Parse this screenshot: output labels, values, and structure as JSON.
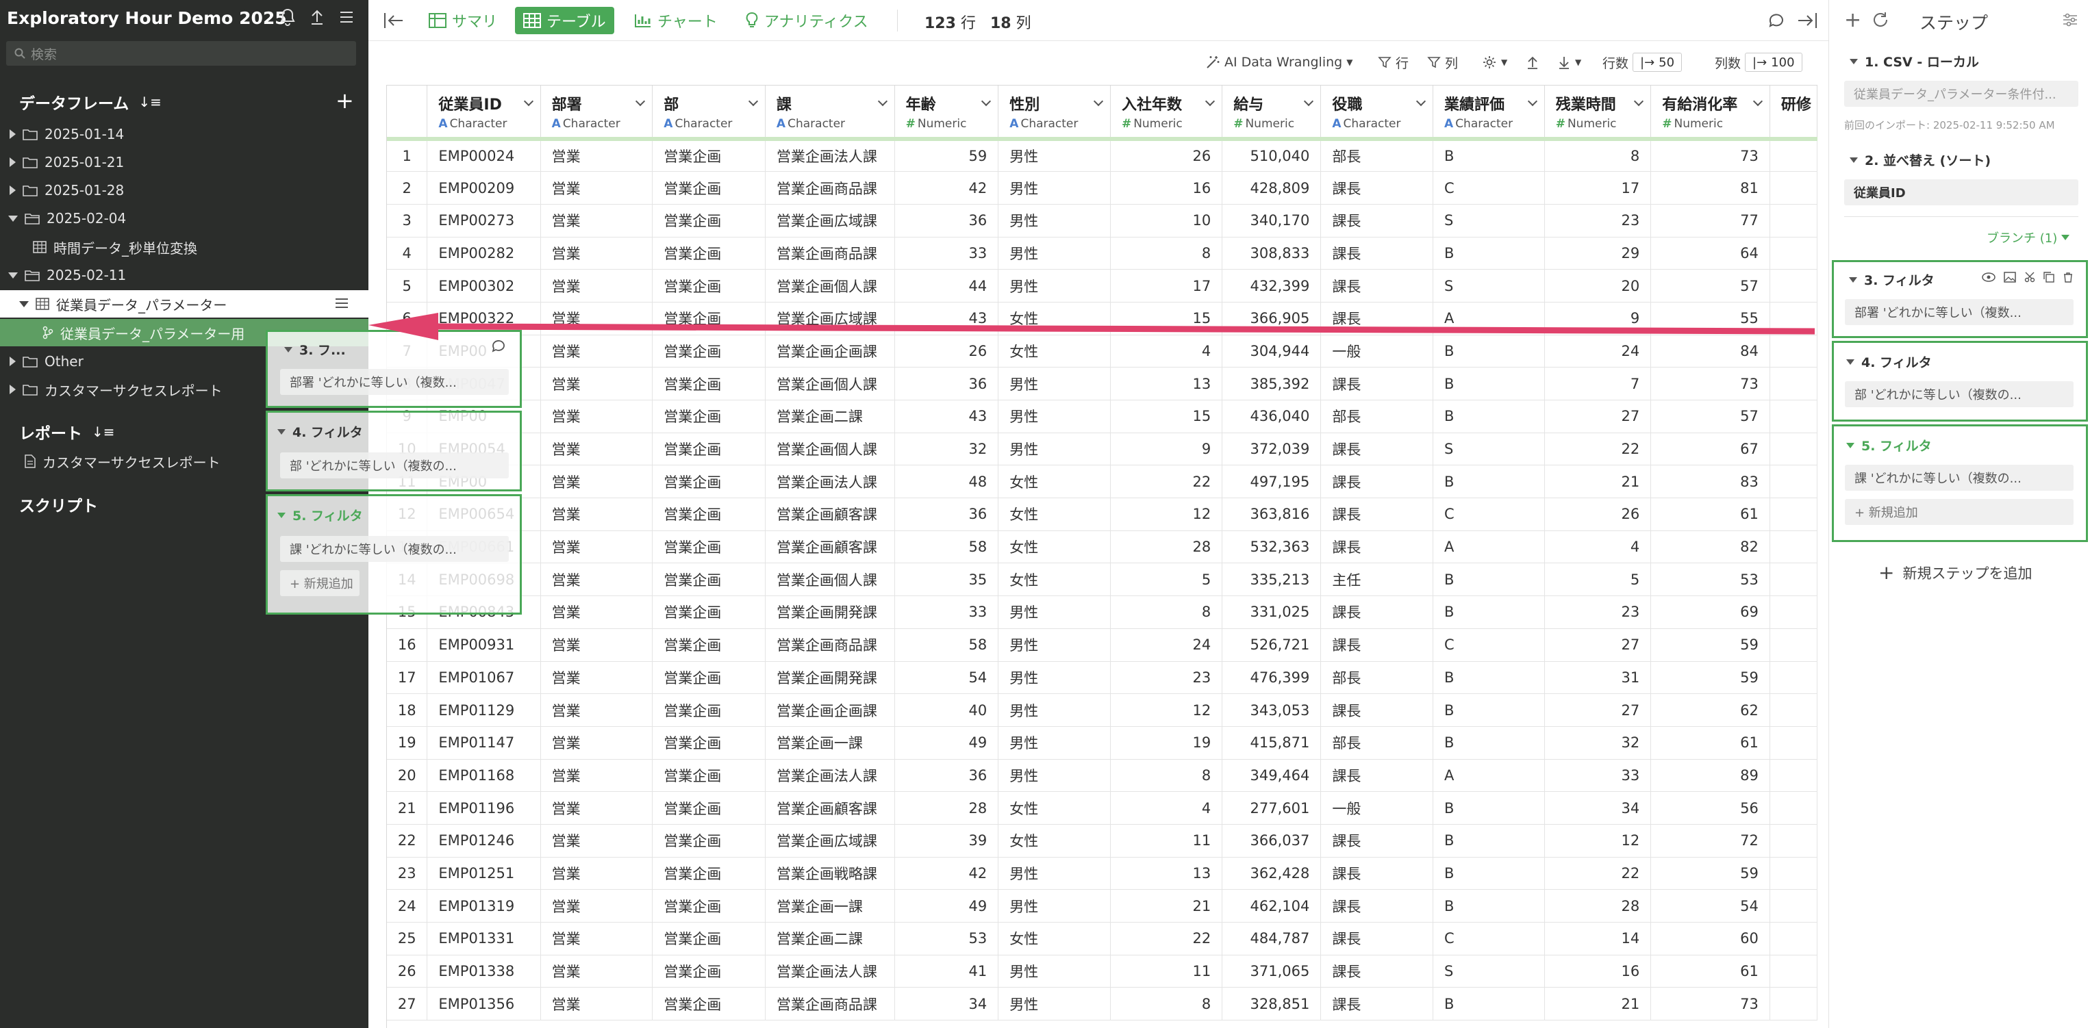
{
  "sidebar": {
    "title": "Exploratory Hour Demo 2025",
    "search_placeholder": "検索",
    "dataframes_heading": "データフレーム",
    "folders": [
      {
        "label": "2025-01-14"
      },
      {
        "label": "2025-01-21"
      },
      {
        "label": "2025-01-28"
      },
      {
        "label": "2025-02-04"
      },
      {
        "label": "時間データ_秒単位変換"
      },
      {
        "label": "2025-02-11"
      },
      {
        "label": "従業員データ_パラメーター"
      },
      {
        "label": "従業員データ_パラメーター用"
      },
      {
        "label": "Other"
      },
      {
        "label": "カスタマーサクセスレポート"
      }
    ],
    "reports_heading": "レポート",
    "report_item": "カスタマーサクセスレポート",
    "scripts_heading": "スクリプト"
  },
  "toolbar": {
    "tabs": [
      "サマリ",
      "テーブル",
      "チャート",
      "アナリティクス"
    ],
    "rows": "123",
    "rows_unit": "行",
    "cols": "18",
    "cols_unit": "列",
    "ai_label": "AI Data Wrangling",
    "row_filter": "行",
    "col_filter": "列",
    "row_count_label": "行数",
    "row_count_value": "50",
    "col_count_label": "列数",
    "col_count_value": "100"
  },
  "table": {
    "columns": [
      {
        "name": "従業員ID",
        "type": "Character"
      },
      {
        "name": "部署",
        "type": "Character"
      },
      {
        "name": "部",
        "type": "Character"
      },
      {
        "name": "課",
        "type": "Character"
      },
      {
        "name": "年齢",
        "type": "Numeric"
      },
      {
        "name": "性別",
        "type": "Character"
      },
      {
        "name": "入社年数",
        "type": "Numeric"
      },
      {
        "name": "給与",
        "type": "Numeric"
      },
      {
        "name": "役職",
        "type": "Character"
      },
      {
        "name": "業績評価",
        "type": "Character"
      },
      {
        "name": "残業時間",
        "type": "Numeric"
      },
      {
        "name": "有給消化率",
        "type": "Numeric"
      },
      {
        "name": "研修",
        "type": ""
      }
    ],
    "rows": [
      [
        "1",
        "EMP00024",
        "営業",
        "営業企画",
        "営業企画法人課",
        "59",
        "男性",
        "26",
        "510,040",
        "部長",
        "B",
        "8",
        "73"
      ],
      [
        "2",
        "EMP00209",
        "営業",
        "営業企画",
        "営業企画商品課",
        "42",
        "男性",
        "16",
        "428,809",
        "課長",
        "C",
        "17",
        "81"
      ],
      [
        "3",
        "EMP00273",
        "営業",
        "営業企画",
        "営業企画広域課",
        "36",
        "男性",
        "10",
        "340,170",
        "課長",
        "S",
        "23",
        "77"
      ],
      [
        "4",
        "EMP00282",
        "営業",
        "営業企画",
        "営業企画商品課",
        "33",
        "男性",
        "8",
        "308,833",
        "課長",
        "B",
        "29",
        "64"
      ],
      [
        "5",
        "EMP00302",
        "営業",
        "営業企画",
        "営業企画個人課",
        "44",
        "男性",
        "17",
        "432,399",
        "課長",
        "S",
        "20",
        "57"
      ],
      [
        "6",
        "EMP00322",
        "営業",
        "営業企画",
        "営業企画広域課",
        "43",
        "女性",
        "15",
        "366,905",
        "課長",
        "A",
        "9",
        "55"
      ],
      [
        "7",
        "EMP00",
        "営業",
        "営業企画",
        "営業企画企画課",
        "26",
        "女性",
        "4",
        "304,944",
        "一般",
        "B",
        "24",
        "84"
      ],
      [
        "8",
        "EMP0047",
        "営業",
        "営業企画",
        "営業企画個人課",
        "36",
        "男性",
        "13",
        "385,392",
        "課長",
        "B",
        "7",
        "73"
      ],
      [
        "9",
        "EMP00",
        "営業",
        "営業企画",
        "営業企画二課",
        "43",
        "男性",
        "15",
        "436,040",
        "部長",
        "B",
        "27",
        "57"
      ],
      [
        "10",
        "EMP0054",
        "営業",
        "営業企画",
        "営業企画個人課",
        "32",
        "男性",
        "9",
        "372,039",
        "課長",
        "S",
        "22",
        "67"
      ],
      [
        "11",
        "EMP00",
        "営業",
        "営業企画",
        "営業企画法人課",
        "48",
        "女性",
        "22",
        "497,195",
        "課長",
        "B",
        "21",
        "83"
      ],
      [
        "12",
        "EMP00654",
        "営業",
        "営業企画",
        "営業企画顧客課",
        "36",
        "女性",
        "12",
        "363,816",
        "課長",
        "C",
        "26",
        "61"
      ],
      [
        "13",
        "EMP00661",
        "営業",
        "営業企画",
        "営業企画顧客課",
        "58",
        "女性",
        "28",
        "532,363",
        "課長",
        "A",
        "4",
        "82"
      ],
      [
        "14",
        "EMP00698",
        "営業",
        "営業企画",
        "営業企画個人課",
        "35",
        "女性",
        "5",
        "335,213",
        "主任",
        "B",
        "5",
        "53"
      ],
      [
        "15",
        "EMP00843",
        "営業",
        "営業企画",
        "営業企画開発課",
        "33",
        "男性",
        "8",
        "331,025",
        "課長",
        "B",
        "23",
        "69"
      ],
      [
        "16",
        "EMP00931",
        "営業",
        "営業企画",
        "営業企画商品課",
        "58",
        "男性",
        "24",
        "526,721",
        "課長",
        "C",
        "27",
        "59"
      ],
      [
        "17",
        "EMP01067",
        "営業",
        "営業企画",
        "営業企画開発課",
        "54",
        "男性",
        "23",
        "476,399",
        "部長",
        "B",
        "31",
        "59"
      ],
      [
        "18",
        "EMP01129",
        "営業",
        "営業企画",
        "営業企画企画課",
        "40",
        "男性",
        "12",
        "343,053",
        "課長",
        "B",
        "27",
        "62"
      ],
      [
        "19",
        "EMP01147",
        "営業",
        "営業企画",
        "営業企画一課",
        "49",
        "男性",
        "19",
        "415,871",
        "部長",
        "B",
        "32",
        "61"
      ],
      [
        "20",
        "EMP01168",
        "営業",
        "営業企画",
        "営業企画法人課",
        "36",
        "男性",
        "8",
        "349,464",
        "課長",
        "A",
        "33",
        "89"
      ],
      [
        "21",
        "EMP01196",
        "営業",
        "営業企画",
        "営業企画顧客課",
        "28",
        "女性",
        "4",
        "277,601",
        "一般",
        "B",
        "34",
        "56"
      ],
      [
        "22",
        "EMP01246",
        "営業",
        "営業企画",
        "営業企画広域課",
        "39",
        "女性",
        "11",
        "366,037",
        "課長",
        "B",
        "12",
        "72"
      ],
      [
        "23",
        "EMP01251",
        "営業",
        "営業企画",
        "営業企画戦略課",
        "42",
        "男性",
        "13",
        "362,428",
        "課長",
        "B",
        "22",
        "59"
      ],
      [
        "24",
        "EMP01319",
        "営業",
        "営業企画",
        "営業企画一課",
        "49",
        "男性",
        "21",
        "462,104",
        "課長",
        "B",
        "28",
        "54"
      ],
      [
        "25",
        "EMP01331",
        "営業",
        "営業企画",
        "営業企画二課",
        "53",
        "女性",
        "22",
        "484,787",
        "課長",
        "C",
        "14",
        "60"
      ],
      [
        "26",
        "EMP01338",
        "営業",
        "営業企画",
        "営業企画法人課",
        "41",
        "男性",
        "11",
        "371,065",
        "課長",
        "S",
        "16",
        "61"
      ],
      [
        "27",
        "EMP01356",
        "営業",
        "営業企画",
        "営業企画商品課",
        "34",
        "男性",
        "8",
        "328,851",
        "課長",
        "B",
        "21",
        "73"
      ]
    ]
  },
  "steps_panel": {
    "title": "ステップ",
    "step1_title": "1. CSV - ローカル",
    "step1_value": "従業員データ_パラメーター条件付...",
    "step1_note": "前回のインポート: 2025-02-11 9:52:50 AM",
    "step2_title": "2. 並べ替え (ソート)",
    "step2_value": "従業員ID",
    "branch": "ブランチ (1)",
    "step3_title": "3. フィルタ",
    "step3_value": "部署 'どれかに等しい（複数...",
    "step4_title": "4. フィルタ",
    "step4_value": "部 'どれかに等しい（複数の...",
    "step5_title": "5. フィルタ",
    "step5_value": "課 'どれかに等しい（複数の...",
    "add_new": "+ 新規追加",
    "add_step": "新規ステップを追加"
  },
  "drag_ghost": {
    "step3_title": "3. フ...",
    "step3_value": "部署 'どれかに等しい（複数...",
    "step4_title": "4. フィルタ",
    "step4_value": "部 'どれかに等しい（複数の...",
    "step5_title": "5. フィルタ",
    "step5_value": "課 'どれかに等しい（複数の...",
    "add_new": "+ 新規追加"
  },
  "colors": {
    "accent": "#4aa857",
    "sidebar_bg": "#2b2d2b",
    "arrow": "#e0416b"
  }
}
